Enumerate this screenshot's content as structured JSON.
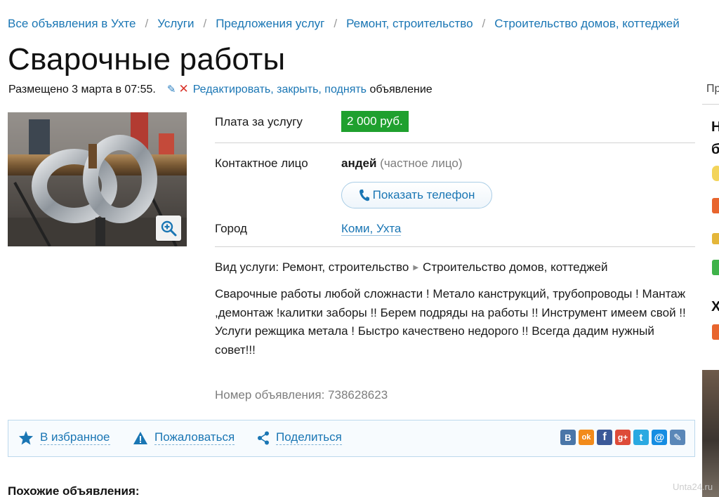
{
  "breadcrumb": [
    "Все объявления в Ухте",
    "Услуги",
    "Предложения услуг",
    "Ремонт, строительство",
    "Строительство домов, коттеджей"
  ],
  "title": "Сварочные работы",
  "posted": {
    "text": "Размещено 3 марта в 07:55.",
    "edit_link": "Редактировать, закрыть, поднять",
    "edit_suffix": " объявление"
  },
  "details": {
    "price_label": "Плата за услугу",
    "price_value": "2 000 руб.",
    "contact_label": "Контактное лицо",
    "contact_name": "андей",
    "contact_type": "(частное лицо)",
    "phone_button": "Показать телефон",
    "city_label": "Город",
    "city_value": "Коми, Ухта"
  },
  "service": {
    "label": "Вид услуги:",
    "category": "Ремонт, строительство",
    "subcategory": "Строительство домов, коттеджей"
  },
  "description": "Сварочные работы любой сложнасти ! Метало канструкций, трубопроводы ! Мантаж ,демонтаж !калитки заборы !! Берем подряды на работы !! Инструмент имеем свой !! Услуги режщика метала ! Быстро качествено недорого !! Всегда дадим нужный совет!!!",
  "ad_number": "Номер объявления: 738628623",
  "actions": {
    "favorite": "В избранное",
    "report": "Пожаловаться",
    "share": "Поделиться"
  },
  "share_icons": [
    {
      "name": "vk-icon",
      "glyph": "B",
      "color": "#4a76a8"
    },
    {
      "name": "odnoklassniki-icon",
      "glyph": "ok",
      "color": "#f28b1b"
    },
    {
      "name": "facebook-icon",
      "glyph": "f",
      "color": "#3b5998"
    },
    {
      "name": "google-plus-icon",
      "glyph": "g+",
      "color": "#dd4b39"
    },
    {
      "name": "twitter-icon",
      "glyph": "t",
      "color": "#2ba9e1"
    },
    {
      "name": "mail-ru-icon",
      "glyph": "@",
      "color": "#168de2"
    },
    {
      "name": "livejournal-icon",
      "glyph": "✎",
      "color": "#5a87b8"
    }
  ],
  "similar_heading": "Похожие объявления:",
  "right_column": {
    "top_text": "Пр",
    "heading_1": "Н",
    "heading_2": "б",
    "heading_3": "Х"
  },
  "watermark": "Unta24.ru",
  "colors": {
    "link": "#1a76b4",
    "price_bg": "#1fa02e",
    "delete": "#d9342b"
  }
}
